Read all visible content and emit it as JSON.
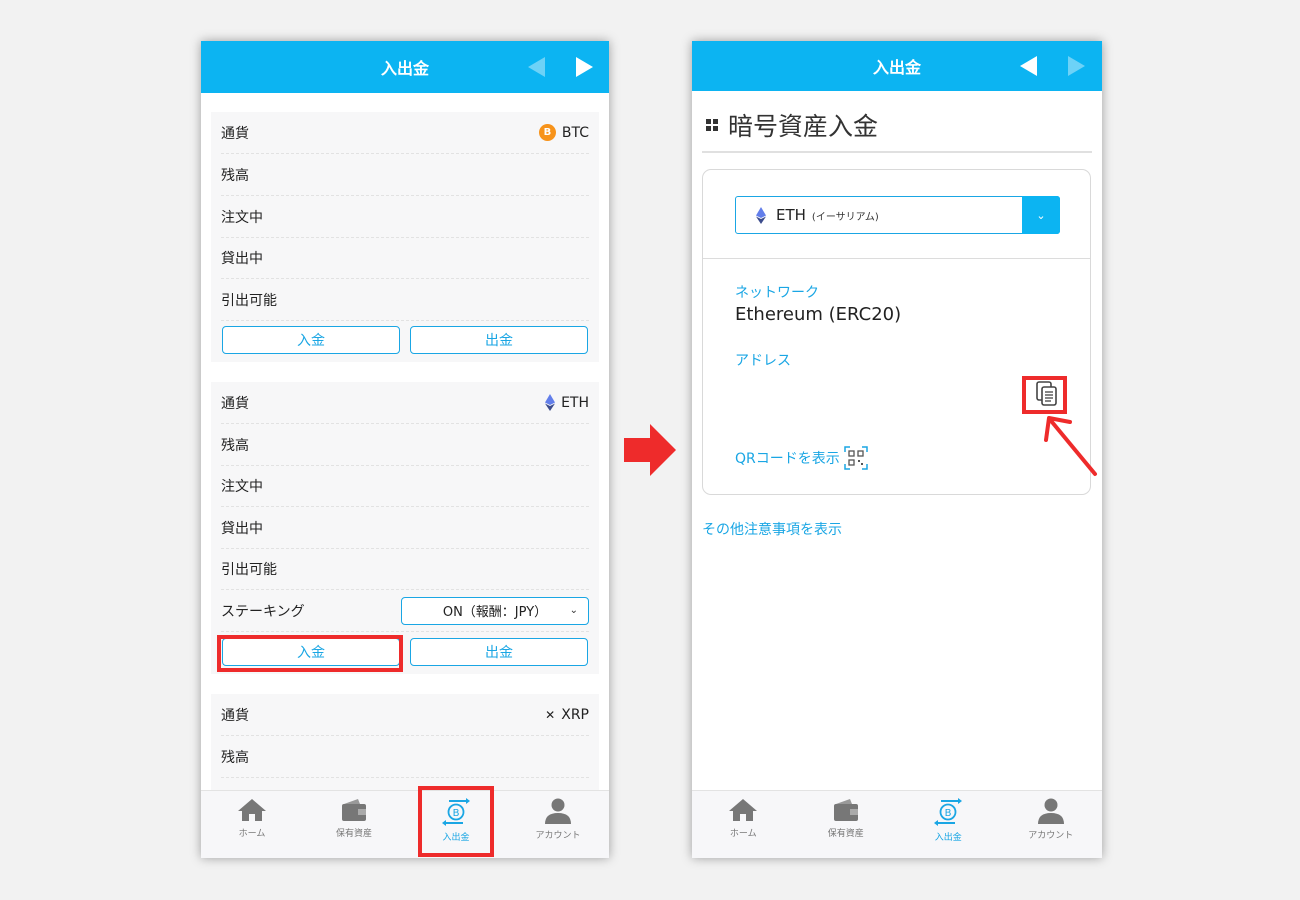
{
  "left_screen": {
    "header": {
      "title": "入出金"
    },
    "cards": [
      {
        "rows": [
          "通貨",
          "残高",
          "注文中",
          "貸出中",
          "引出可能"
        ],
        "coin": {
          "icon": "bitcoin-icon",
          "symbol": "BTC",
          "icon_glyph": "B"
        },
        "buttons": {
          "deposit": "入金",
          "withdraw": "出金"
        }
      },
      {
        "rows": [
          "通貨",
          "残高",
          "注文中",
          "貸出中",
          "引出可能",
          "ステーキング"
        ],
        "coin": {
          "icon": "ethereum-icon",
          "symbol": "ETH"
        },
        "staking": {
          "value": "ON（報酬：JPY）"
        },
        "buttons": {
          "deposit": "入金",
          "withdraw": "出金"
        }
      },
      {
        "rows": [
          "通貨",
          "残高"
        ],
        "coin": {
          "icon": "xrp-icon",
          "symbol": "XRP",
          "icon_glyph": "✕"
        }
      }
    ],
    "nav": [
      "ホーム",
      "保有資産",
      "入出金",
      "アカウント"
    ],
    "active_nav": "入出金"
  },
  "right_screen": {
    "header": {
      "title": "入出金"
    },
    "page_title": "暗号資産入金",
    "currency_select": {
      "symbol": "ETH",
      "name": "(イーサリアム)",
      "icon": "ethereum-icon"
    },
    "network_label": "ネットワーク",
    "network_value": "Ethereum (ERC20)",
    "address_label": "アドレス",
    "qr_link": "QRコードを表示",
    "notes_link": "その他注意事項を表示",
    "nav": [
      "ホーム",
      "保有資産",
      "入出金",
      "アカウント"
    ],
    "active_nav": "入出金"
  },
  "colors": {
    "primary": "#0cb4f2",
    "link": "#1aa6e4",
    "highlight": "#ee2b2b",
    "btc": "#f7931a",
    "eth": "#627eea"
  }
}
